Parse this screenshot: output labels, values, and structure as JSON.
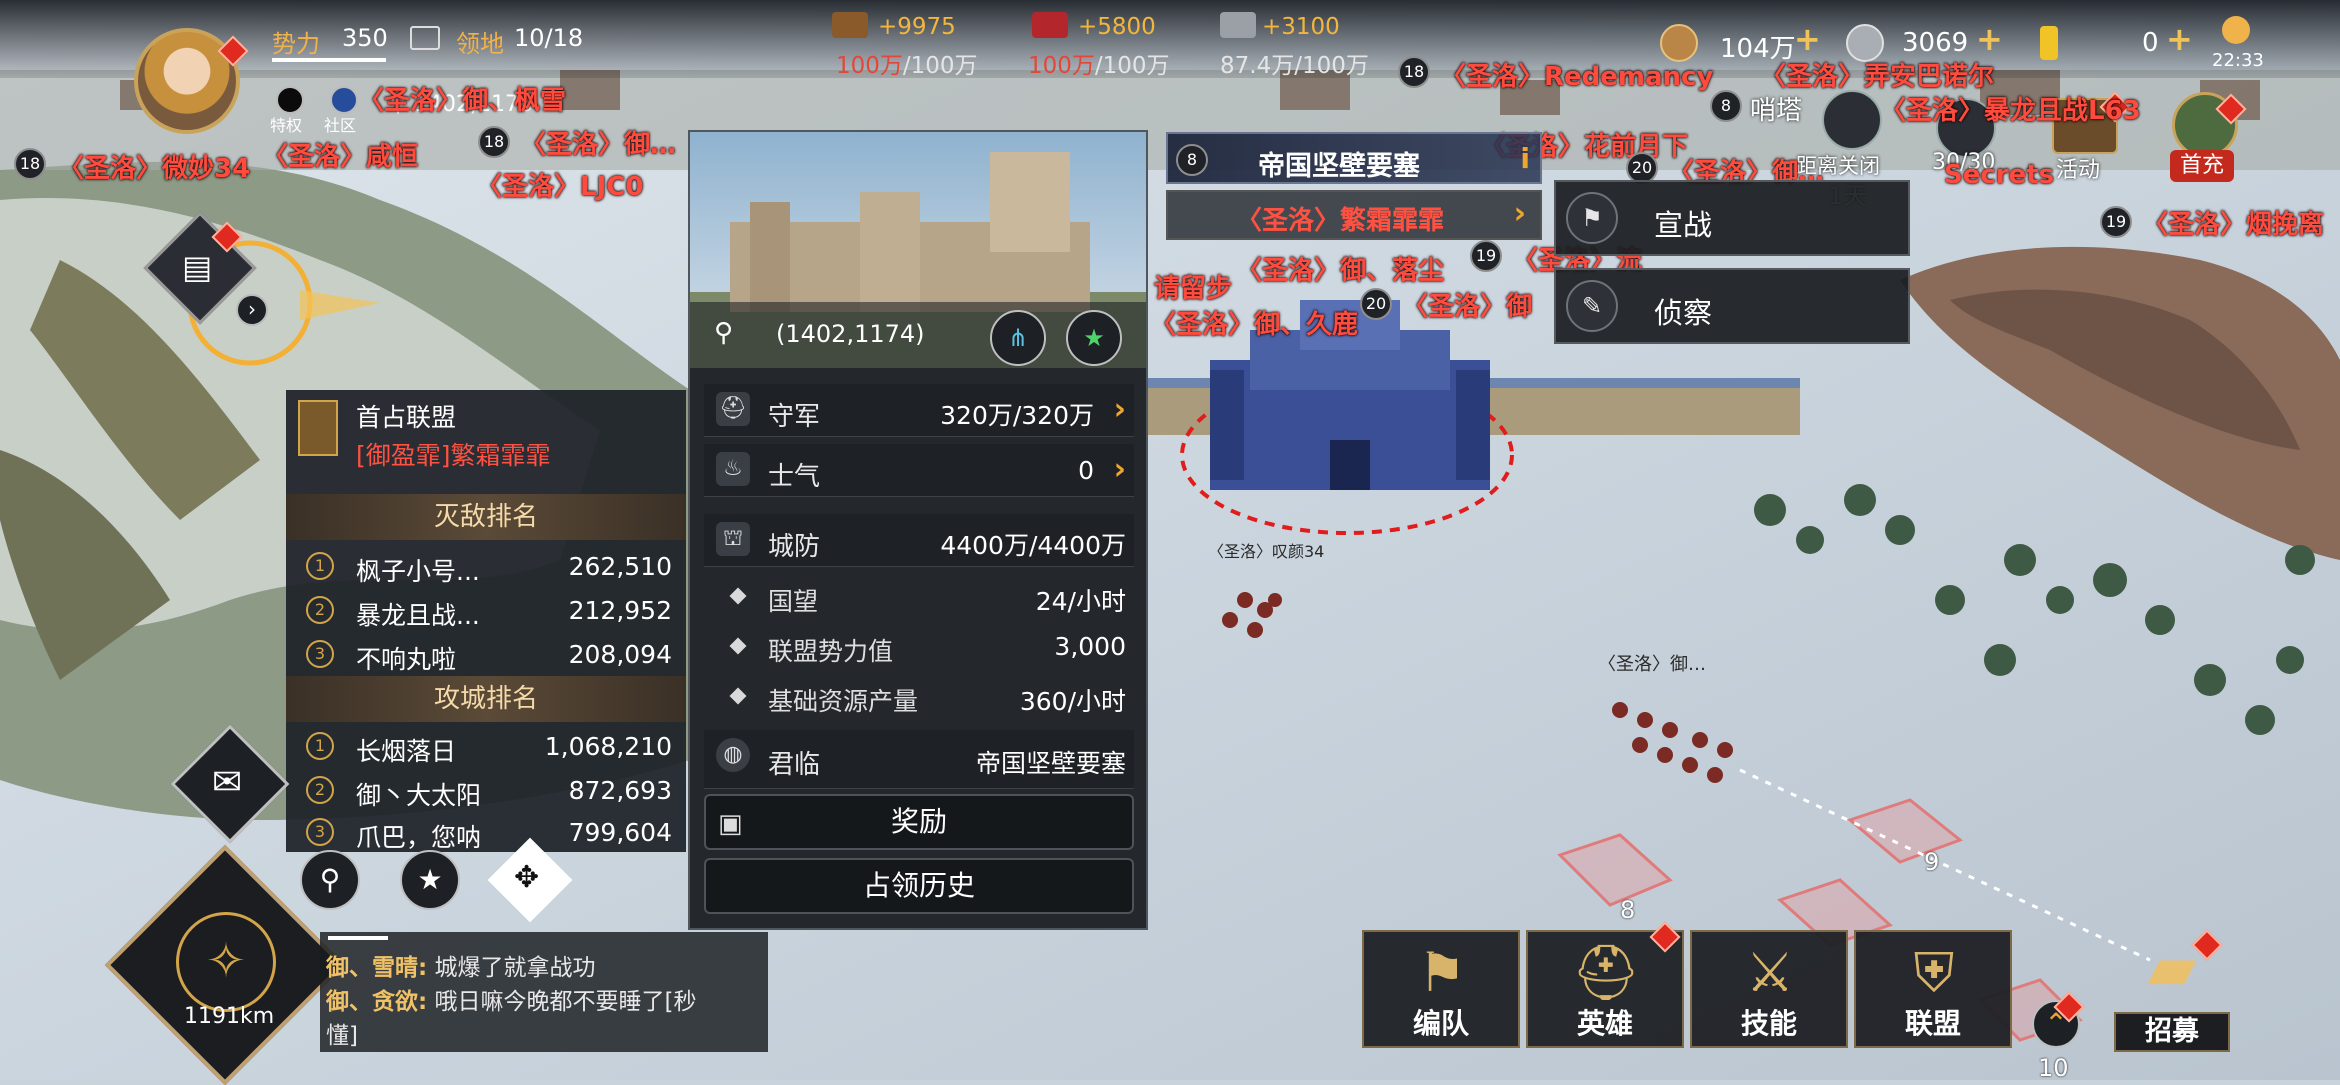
{
  "top": {
    "power_label": "势力",
    "power_value": "350",
    "territory_label": "领地",
    "territory_value": "10/18",
    "coords": "1402,1178",
    "sub_labels": [
      "特权",
      "社区"
    ],
    "resources": [
      {
        "icon": "wood-icon",
        "gain": "+9975",
        "current": "100万",
        "cap": "/100万"
      },
      {
        "icon": "brick-icon",
        "gain": "+5800",
        "current": "100万",
        "cap": "/100万"
      },
      {
        "icon": "iron-icon",
        "gain": "+3100",
        "current": "87.4万",
        "cap": "/100万"
      }
    ],
    "gold": "104万",
    "silver": "3069",
    "gems": "0",
    "clock": "22:33"
  },
  "right_shortcuts": {
    "tower_level": "8",
    "tower_label": "哨塔",
    "gate_label": "距离关闭",
    "gate_days": "1天",
    "troops": "30/30",
    "activity": "活动",
    "first_recharge": "首充"
  },
  "map_tags": [
    {
      "lvl": "18",
      "text": "〈圣洛〉微妙34"
    },
    {
      "lvl": "",
      "text": "〈圣洛〉咸恒"
    },
    {
      "lvl": "18",
      "text": "〈圣洛〉御…"
    },
    {
      "lvl": "",
      "text": "〈圣洛〉LJC0"
    },
    {
      "lvl": "",
      "text": "〈圣洛〉御、枫雪"
    },
    {
      "lvl": "18",
      "text": "〈圣洛〉Redemancy"
    },
    {
      "lvl": "",
      "text": "〈圣洛〉弄安巴诺尔"
    },
    {
      "lvl": "",
      "text": "〈圣洛〉暴龙且战L63"
    },
    {
      "lvl": "",
      "text": "〈圣洛〉花前月下"
    },
    {
      "lvl": "20",
      "text": "〈圣洛〉御…"
    },
    {
      "lvl": "",
      "text": "Secrets"
    },
    {
      "lvl": "19",
      "text": "〈圣洛〉烟挽离"
    },
    {
      "lvl": "",
      "text": "请留步"
    },
    {
      "lvl": "",
      "text": "〈圣洛〉御、落尘"
    },
    {
      "lvl": "19",
      "text": "〈圣洛〉流"
    },
    {
      "lvl": "",
      "text": "〈圣洛〉御、久鹿"
    },
    {
      "lvl": "20",
      "text": "〈圣洛〉御"
    }
  ],
  "army_tags": [
    "〈圣洛〉叹颜34",
    "〈圣洛〉御…"
  ],
  "tile_numbers": [
    "9",
    "8",
    "10"
  ],
  "fortress": {
    "level": "8",
    "name": "帝国坚壁要塞",
    "owner": "〈圣洛〉繁霜霏霏"
  },
  "panel": {
    "coords": "(1402,1174)",
    "rows": [
      {
        "icon": "helmet-icon",
        "label": "守军",
        "value": "320万/320万"
      },
      {
        "icon": "flame-icon",
        "label": "士气",
        "value": "0"
      },
      {
        "icon": "defense-icon",
        "label": "城防",
        "value": "4400万/4400万"
      }
    ],
    "stats": [
      {
        "label": "国望",
        "value": "24/小时"
      },
      {
        "label": "联盟势力值",
        "value": "3,000"
      },
      {
        "label": "基础资源产量",
        "value": "360/小时"
      }
    ],
    "reign_label": "君临",
    "reign_value": "帝国坚壁要塞",
    "reward_button": "奖励",
    "history_button": "占领历史"
  },
  "actions": [
    "宣战",
    "侦察"
  ],
  "rank_panel": {
    "title": "首占联盟",
    "alliance": "[御盈霏]繁霜霏霏",
    "kill_header": "灭敌排名",
    "kill": [
      {
        "no": "1",
        "name": "枫子小号...",
        "score": "262,510"
      },
      {
        "no": "2",
        "name": "暴龙且战...",
        "score": "212,952"
      },
      {
        "no": "3",
        "name": "不响丸啦",
        "score": "208,094"
      }
    ],
    "siege_header": "攻城排名",
    "siege": [
      {
        "no": "1",
        "name": "长烟落日",
        "score": "1,068,210"
      },
      {
        "no": "2",
        "name": "御丶大太阳",
        "score": "872,693"
      },
      {
        "no": "3",
        "name": "爪巴，您呐",
        "score": "799,604"
      }
    ]
  },
  "chat": [
    {
      "user": "御、雪晴:",
      "msg": "城爆了就拿战功"
    },
    {
      "user": "御、贪欲:",
      "msg": "哦日嘛今晚都不要睡了[秒"
    },
    {
      "user": "",
      "msg": "懂]"
    }
  ],
  "compass_distance": "1191km",
  "bottom_nav": [
    "编队",
    "英雄",
    "技能",
    "联盟",
    "招募"
  ],
  "colors": {
    "accent_gold": "#f0a62e",
    "enemy_red": "#ff4b3e",
    "panel_bg": "#24282d"
  }
}
